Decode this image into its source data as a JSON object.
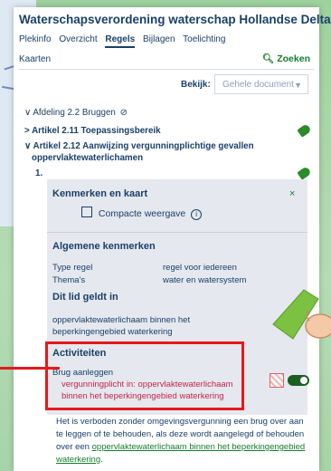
{
  "header": {
    "title": "Waterschapsverordening waterschap Hollandse Delta"
  },
  "tabs": [
    "Plekinfo",
    "Overzicht",
    "Regels",
    "Bijlagen",
    "Toelichting"
  ],
  "active_tab": "Regels",
  "kaarten_label": "Kaarten",
  "search_label": "Zoeken",
  "bekijk": {
    "label": "Bekijk:",
    "value": "Gehele document"
  },
  "tree": {
    "afdeling": "Afdeling 2.2 Bruggen",
    "artikel_211": "Artikel 2.11 Toepassingsbereik",
    "artikel_212_line1": "Artikel 2.12 Aanwijzing vergunningplichtige gevallen",
    "artikel_212_line2": "oppervlaktewaterlichamen",
    "lid": "1."
  },
  "detail": {
    "kenmerken_title": "Kenmerken en kaart",
    "compact_label": "Compacte weergave",
    "algemene_title": "Algemene kenmerken",
    "type_regel_label": "Type regel",
    "type_regel_value": "regel voor iedereen",
    "themas_label": "Thema's",
    "themas_value": "water en watersystem",
    "dit_lid_title": "Dit lid geldt in",
    "geldt_in_line1": "oppervlaktewaterlichaam binnen het",
    "geldt_in_line2": "beperkingengebied waterkering",
    "activiteiten_title": "Activiteiten",
    "activiteit_name": "Brug aanleggen",
    "activiteit_detail_line1": "vergunningplicht in: oppervlaktewaterlichaam",
    "activiteit_detail_line2": "binnen het beperkingengebied waterkering"
  },
  "body": {
    "text_part1": "Het is verboden zonder omgevingsvergunning een brug over aan te leggen of te behouden, als deze wordt aangelegd of behouden over een ",
    "link_text": "oppervlaktewaterlichaam binnen het beperkingengebied waterkering",
    "text_end": "."
  },
  "colors": {
    "primary": "#1b3f6a",
    "accent_green": "#167c2e",
    "highlight_red": "#e31b1b"
  }
}
